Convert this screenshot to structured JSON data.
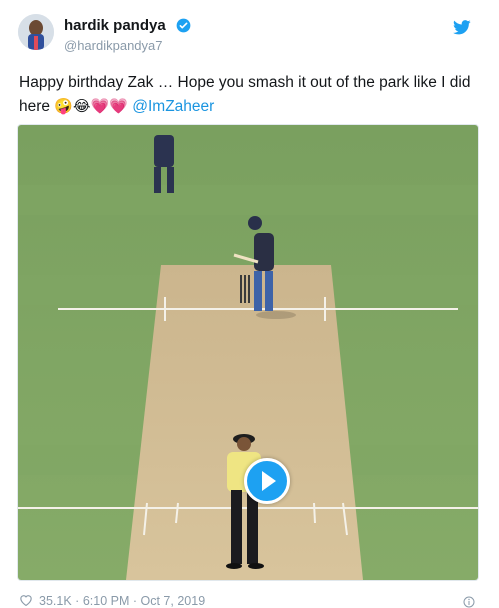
{
  "tweet": {
    "display_name": "hardik pandya",
    "handle": "@hardikpandya7",
    "text_part1": "Happy birthday Zak … Hope you smash it out of the park like I did here ",
    "emojis": [
      "🤪",
      "😂",
      "💗",
      "💗"
    ],
    "mention": "@ImZaheer",
    "like_count": "35.1K",
    "separator": "·",
    "time": "6:10 PM",
    "date": "Oct 7, 2019"
  },
  "icons": {
    "verified": "verified-badge-icon",
    "logo": "twitter-bird-icon",
    "play": "play-icon",
    "like": "heart-icon",
    "info": "info-icon"
  },
  "colors": {
    "link": "#1b95e0",
    "brand": "#1da1f2",
    "muted": "#8a9aa9"
  }
}
